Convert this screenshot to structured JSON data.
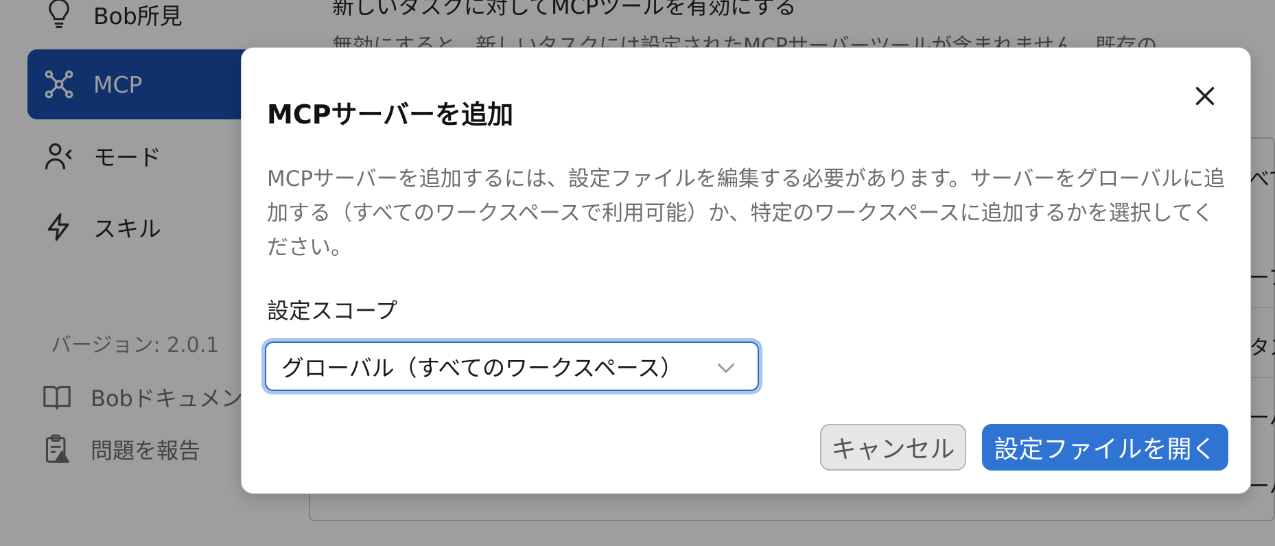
{
  "sidebar": {
    "items": [
      {
        "label": "Bob所見",
        "icon": "lightbulb-icon",
        "active": false
      },
      {
        "label": "MCP",
        "icon": "mcp-network-icon",
        "active": true
      },
      {
        "label": "モード",
        "icon": "user-mode-icon",
        "active": false
      },
      {
        "label": "スキル",
        "icon": "lightning-icon",
        "active": false
      }
    ],
    "version": "バージョン: 2.0.1",
    "links": [
      {
        "label": "Bobドキュメント",
        "icon": "book-icon"
      },
      {
        "label": "問題を報告",
        "icon": "report-issue-icon"
      }
    ]
  },
  "main": {
    "toggle_title": "新しいタスクに対してMCPツールを有効にする",
    "toggle_desc": "無効にすると、新しいタスクには設定されたMCPサーバーツールが含まれません。既存の",
    "row_fragments": [
      "ーフ",
      "ーバ",
      "ーバ",
      "ーバ"
    ],
    "right_fragments": [
      "べて",
      "タス"
    ]
  },
  "dialog": {
    "title": "MCPサーバーを追加",
    "description": "MCPサーバーを追加するには、設定ファイルを編集する必要があります。サーバーをグローバルに追加する（すべてのワークスペースで利用可能）か、特定のワークスペースに追加するかを選択してください。",
    "scope_label": "設定スコープ",
    "scope_selected": "グローバル（すべてのワークスペース）",
    "cancel_label": "キャンセル",
    "open_label": "設定ファイルを開く"
  },
  "colors": {
    "accent": "#2f73d3",
    "sidebar_active": "#1c4fb1"
  }
}
